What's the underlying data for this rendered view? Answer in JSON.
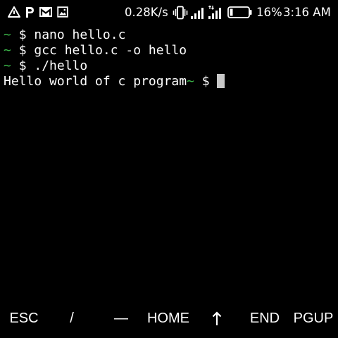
{
  "status_bar": {
    "left_icons": [
      "warning-triangle-icon",
      "parking-icon",
      "gmail-icon",
      "image-notification-icon"
    ],
    "network_speed": "0.28K/s",
    "right_icons": [
      "vibrate-icon",
      "signal-icon",
      "data-signal-icon",
      "battery-icon"
    ],
    "battery_percent": "16%",
    "battery_level": 0.16,
    "clock": "3:16 AM"
  },
  "terminal": {
    "prompt_symbol": "~",
    "prompt_dollar": "$",
    "lines": [
      {
        "command": "nano hello.c"
      },
      {
        "command": "gcc hello.c -o hello"
      },
      {
        "command": "./hello"
      }
    ],
    "output": "Hello world of c program"
  },
  "extra_keys": {
    "esc": "ESC",
    "slash": "/",
    "dash": "—",
    "home": "HOME",
    "arrow_up": "↑",
    "end": "END",
    "pgup": "PGUP"
  },
  "colors": {
    "background": "#000000",
    "prompt_green": "#3cb84a",
    "text": "#ffffff",
    "cursor": "#c8c8c8"
  }
}
